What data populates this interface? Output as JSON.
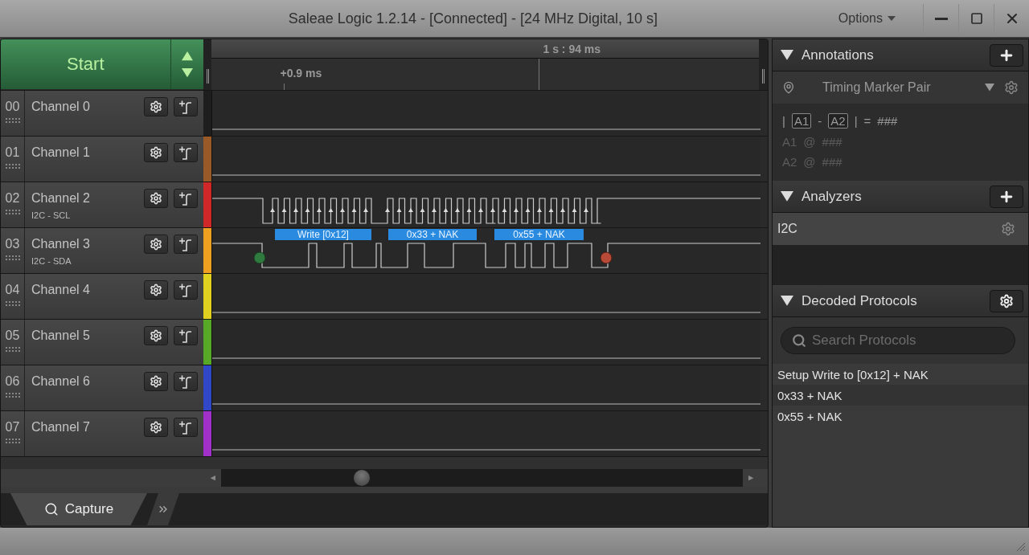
{
  "window": {
    "title": "Saleae Logic 1.2.14 - [Connected] - [24 MHz Digital, 10 s]",
    "menu": "Options"
  },
  "start_button": {
    "label": "Start"
  },
  "timeline": {
    "time": "1 s : 94 ms",
    "offset": "+0.9 ms"
  },
  "channels": [
    {
      "number": "00",
      "name": "Channel 0",
      "color": "#1e1e1e",
      "kind": "flat"
    },
    {
      "number": "01",
      "name": "Channel 1",
      "color": "#9a5a28",
      "kind": "flat"
    },
    {
      "number": "02",
      "name": "Channel 2",
      "analyzer": "I2C - SCL",
      "color": "#d02828",
      "kind": "clock"
    },
    {
      "number": "03",
      "name": "Channel 3",
      "analyzer": "I2C - SDA",
      "color": "#f0a020",
      "kind": "data",
      "decoded": [
        "Write [0x12]",
        "0x33 + NAK",
        "0x55 + NAK"
      ]
    },
    {
      "number": "04",
      "name": "Channel 4",
      "color": "#e0d020",
      "kind": "flat"
    },
    {
      "number": "05",
      "name": "Channel 5",
      "color": "#58a828",
      "kind": "flat"
    },
    {
      "number": "06",
      "name": "Channel 6",
      "color": "#3048c8",
      "kind": "flat"
    },
    {
      "number": "07",
      "name": "Channel 7",
      "color": "#a030c8",
      "kind": "flat"
    }
  ],
  "capture_tab": {
    "label": "Capture",
    "selected": true
  },
  "annotations": {
    "title": "Annotations",
    "marker_type": "Timing Marker Pair",
    "measurement": {
      "open": "|",
      "a": "A1",
      "dash": "-",
      "b": "A2",
      "close": "|",
      "equals": "=",
      "value": "###"
    },
    "markers": [
      {
        "name": "A1",
        "at": "@",
        "value": "###"
      },
      {
        "name": "A2",
        "at": "@",
        "value": "###"
      }
    ]
  },
  "analyzers": {
    "title": "Analyzers",
    "items": [
      {
        "name": "I2C"
      }
    ]
  },
  "decoded_protocols": {
    "title": "Decoded Protocols",
    "search": {
      "placeholder": "Search Protocols"
    },
    "rows": [
      "Setup Write to [0x12] + NAK",
      "0x33 + NAK",
      "0x55 + NAK"
    ]
  }
}
